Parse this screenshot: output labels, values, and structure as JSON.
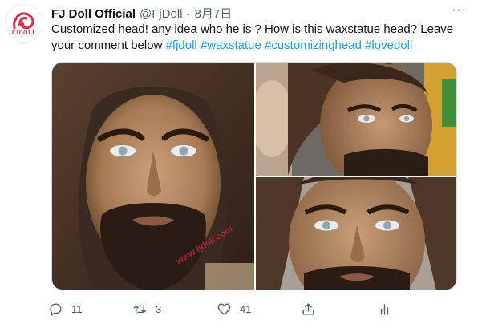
{
  "tweet": {
    "author_name": "FJ Doll Official",
    "handle": "@FjDoll",
    "separator": "·",
    "date": "8月7日",
    "more_label": "···",
    "text_plain": "Customized head!  any idea who he is ? How is this waxstatue head?  Leave your comment below ",
    "hashtags": [
      "#fjdoll",
      "#waxstatue",
      "#customizinghead",
      "#lovedoll"
    ],
    "avatar_logo_text": "FJDOLL",
    "watermark_text": "www.fjdoll.com"
  },
  "actions": {
    "reply_count": "11",
    "retweet_count": "3",
    "like_count": "41"
  },
  "icons": {
    "reply": "reply-icon",
    "retweet": "retweet-icon",
    "like": "heart-icon",
    "share": "share-icon",
    "analytics": "analytics-icon"
  },
  "colors": {
    "link": "#1d9bf0",
    "muted": "#536471",
    "brand": "#d9304a"
  }
}
